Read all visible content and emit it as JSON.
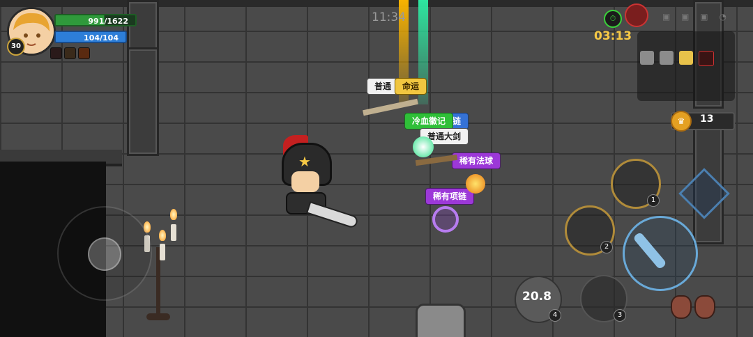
{
  "hud": {
    "level": "30",
    "hp": "991/1622",
    "hp_fraction": 0.61,
    "mp": "104/104",
    "mp_fraction": 1.0,
    "clock": "11:34",
    "timer": "03:13",
    "coins": "13"
  },
  "items": [
    {
      "label": "普通",
      "rarity": "common"
    },
    {
      "label": "命运",
      "rarity": "legendary"
    },
    {
      "label": "冷血徽记",
      "rarity": "uncommon"
    },
    {
      "label": "链",
      "rarity": "rare"
    },
    {
      "label": "普通大剑",
      "rarity": "common"
    },
    {
      "label": "稀有法球",
      "rarity": "epic"
    },
    {
      "label": "稀有项链",
      "rarity": "epic"
    }
  ],
  "skills": {
    "skill1_key": "1",
    "skill2_key": "2",
    "skill3_key": "3",
    "skill4_key": "4",
    "cooldown": "20.8"
  },
  "colors": {
    "hp": "#2f9a3b",
    "mp": "#2d7ed8",
    "timer": "#f7c945",
    "legendary": "#f1c640",
    "epic": "#9c38d8",
    "uncommon": "#2fbf38",
    "rare": "#3572d6"
  },
  "icons": [
    "hero-avatar-icon",
    "stopwatch-icon",
    "boss-skull-icon",
    "minimap-room-icon",
    "gold-coin-icon",
    "sword-attack-icon",
    "skill-icon"
  ]
}
